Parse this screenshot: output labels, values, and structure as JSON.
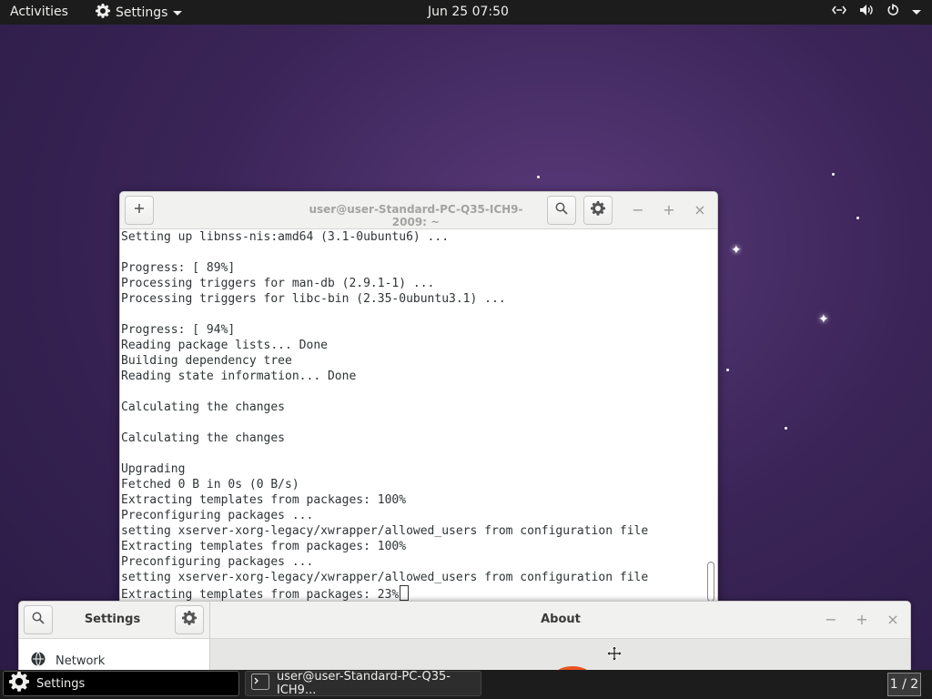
{
  "topbar": {
    "activities": "Activities",
    "app_name": "Settings",
    "clock": "Jun 25  07:50",
    "status_icons": [
      "network-icon",
      "volume-icon",
      "power-icon"
    ]
  },
  "terminal": {
    "title": "user@user-Standard-PC-Q35-ICH9-2009: ~",
    "lines": [
      "Setting up libnss-nis:amd64 (3.1-0ubuntu6) ...",
      "",
      "Progress: [ 89%]",
      "Processing triggers for man-db (2.9.1-1) ...",
      "Processing triggers for libc-bin (2.35-0ubuntu3.1) ...",
      "",
      "Progress: [ 94%]",
      "Reading package lists... Done",
      "Building dependency tree",
      "Reading state information... Done",
      "",
      "Calculating the changes",
      "",
      "Calculating the changes",
      "",
      "Upgrading",
      "Fetched 0 B in 0s (0 B/s)",
      "Extracting templates from packages: 100%",
      "Preconfiguring packages ...",
      "setting xserver-xorg-legacy/xwrapper/allowed_users from configuration file",
      "Extracting templates from packages: 100%",
      "Preconfiguring packages ...",
      "setting xserver-xorg-legacy/xwrapper/allowed_users from configuration file",
      "Extracting templates from packages: 23%"
    ],
    "minimize": "−",
    "maximize": "+",
    "close": "×"
  },
  "settings": {
    "sidebar_title": "Settings",
    "panel_title": "About",
    "sidebar_items": [
      {
        "label": "Network",
        "icon": "network-globe-icon"
      }
    ],
    "minimize": "−",
    "maximize": "+",
    "close": "×"
  },
  "taskbar": {
    "tasks": [
      {
        "label": "Settings",
        "icon": "gear-icon",
        "active": true
      },
      {
        "label": "user@user-Standard-PC-Q35-ICH9...",
        "icon": "terminal-icon",
        "active": false
      }
    ],
    "workspace": "1 / 2"
  },
  "colors": {
    "topbar_bg": "#1c1c1c",
    "desktop": "#3b2558",
    "accent": "#e95420"
  }
}
